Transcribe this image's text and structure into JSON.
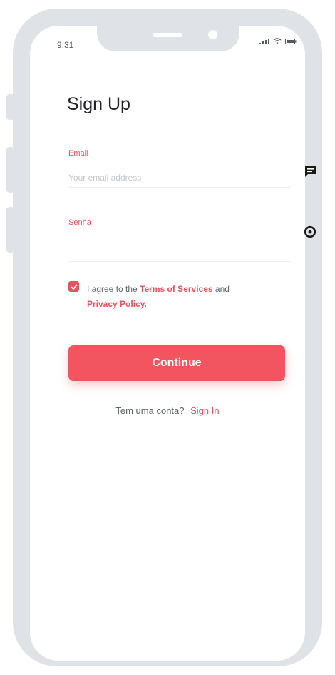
{
  "status_bar": {
    "time": "9:31",
    "icons": [
      "signal-icon",
      "wifi-icon",
      "battery-icon"
    ]
  },
  "form": {
    "title": "Sign Up",
    "email": {
      "label": "Email",
      "placeholder": "Your email address",
      "value": ""
    },
    "password": {
      "label": "Senha",
      "placeholder": "",
      "value": ""
    },
    "terms": {
      "checked": true,
      "prefix": "I agree to the",
      "terms_link": "Terms of Services",
      "and": "and",
      "privacy_link": "Privacy Policy."
    },
    "continue_label": "Continue"
  },
  "signin": {
    "prompt": "Tem uma conta?",
    "link": "Sign In"
  },
  "side_tools": [
    "comment-icon",
    "settings-icon"
  ],
  "colors": {
    "accent": "#f2555f",
    "frame": "#dfe3e8",
    "text_dark": "#222428",
    "text_muted": "#5f646a"
  }
}
